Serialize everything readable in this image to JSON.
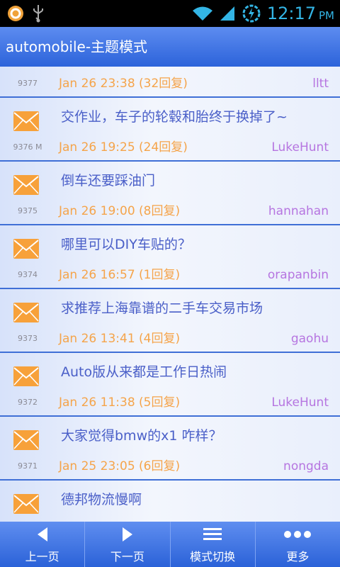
{
  "status": {
    "time": "12:17",
    "ampm": "PM"
  },
  "header": {
    "title": "automobile-主题模式"
  },
  "colors": {
    "title_bar": "#2c63da",
    "date": "#f5a44a",
    "user": "#b675e0",
    "subject": "#4a5fc8",
    "divider": "#3f6fd6"
  },
  "threads": [
    {
      "num": "9377",
      "title": "",
      "date": "Jan 26 23:38 (32回复)",
      "user": "lltt",
      "icon": ""
    },
    {
      "num": "9376  M",
      "title": "交作业，车子的轮毂和胎终于换掉了~",
      "date": "Jan 26 19:25 (24回复)",
      "user": "LukeHunt",
      "icon": "envelope-icon"
    },
    {
      "num": "9375",
      "title": "倒车还要踩油门",
      "date": "Jan 26 19:00 (8回复)",
      "user": "hannahan",
      "icon": "envelope-icon"
    },
    {
      "num": "9374",
      "title": "哪里可以DIY车贴的？",
      "date": "Jan 26 16:57 (1回复)",
      "user": "orapanbin",
      "icon": "envelope-icon"
    },
    {
      "num": "9373",
      "title": "求推荐上海靠谱的二手车交易市场",
      "date": "Jan 26 13:41 (4回复)",
      "user": "gaohu",
      "icon": "envelope-icon"
    },
    {
      "num": "9372",
      "title": "Auto版从来都是工作日热闹",
      "date": "Jan 26 11:38 (5回复)",
      "user": "LukeHunt",
      "icon": "envelope-icon"
    },
    {
      "num": "9371",
      "title": "大家觉得bmw的x1 咋样？",
      "date": "Jan 25 23:05 (6回复)",
      "user": "nongda",
      "icon": "envelope-icon"
    },
    {
      "num": "",
      "title": "德邦物流慢啊",
      "date": "",
      "user": "",
      "icon": "envelope-icon"
    }
  ],
  "toolbar": {
    "prev": "上一页",
    "next": "下一页",
    "mode": "模式切换",
    "more": "更多"
  }
}
